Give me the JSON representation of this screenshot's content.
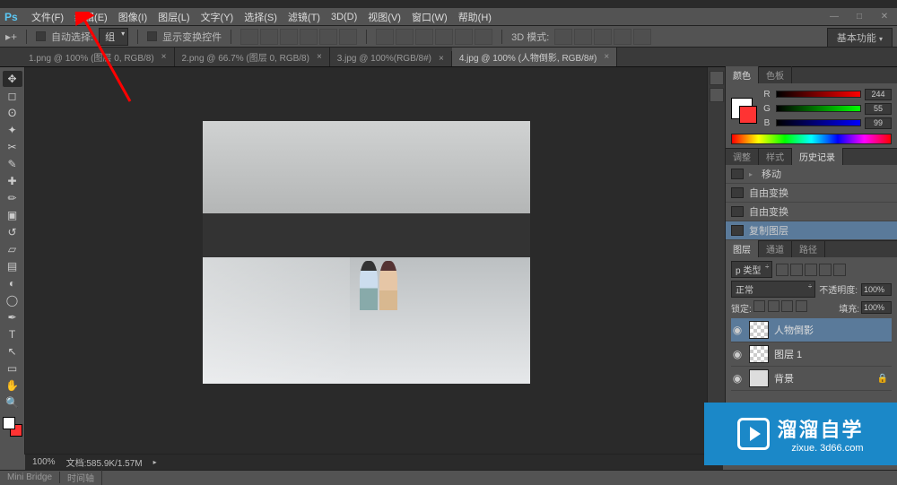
{
  "menu": {
    "items": [
      "文件(F)",
      "编辑(E)",
      "图像(I)",
      "图层(L)",
      "文字(Y)",
      "选择(S)",
      "滤镜(T)",
      "3D(D)",
      "视图(V)",
      "窗口(W)",
      "帮助(H)"
    ]
  },
  "options": {
    "tool_label": "自动选择:",
    "group_select": "组",
    "transform_label": "显示变换控件",
    "mode3d_label": "3D 模式:",
    "func_button": "基本功能"
  },
  "tabs": {
    "items": [
      {
        "label": "1.png @ 100% (图层 0, RGB/8)",
        "active": false
      },
      {
        "label": "2.png @ 66.7% (图层 0, RGB/8)",
        "active": false
      },
      {
        "label": "3.jpg @ 100%(RGB/8#)",
        "active": false
      },
      {
        "label": "4.jpg @ 100% (人物倒影, RGB/8#)",
        "active": true
      }
    ]
  },
  "color_panel": {
    "tabs": [
      "颜色",
      "色板"
    ],
    "r_label": "R",
    "g_label": "G",
    "b_label": "B",
    "r": "244",
    "g": "55",
    "b": "99"
  },
  "adjust_panel": {
    "tabs": [
      "调整",
      "样式",
      "历史记录"
    ],
    "items": [
      "移动",
      "自由变换",
      "自由变换",
      "复制图层"
    ],
    "active_index": 3
  },
  "layers_panel": {
    "tabs": [
      "图层",
      "通道",
      "路径"
    ],
    "kind_label": "p 类型",
    "blend_mode": "正常",
    "opacity_label": "不透明度:",
    "opacity_value": "100%",
    "lock_label": "锁定:",
    "fill_label": "填充:",
    "fill_value": "100%",
    "layers": [
      {
        "name": "人物倒影",
        "selected": true,
        "locked": false
      },
      {
        "name": "图层 1",
        "selected": false,
        "locked": false
      },
      {
        "name": "背景",
        "selected": false,
        "locked": true
      }
    ]
  },
  "status": {
    "zoom": "100%",
    "doc_label": "文档:585.9K/1.57M"
  },
  "bottom_tabs": {
    "items": [
      "Mini Bridge",
      "时间轴"
    ]
  },
  "watermark": {
    "main": "溜溜自学",
    "sub": "zixue. 3d66.com"
  }
}
